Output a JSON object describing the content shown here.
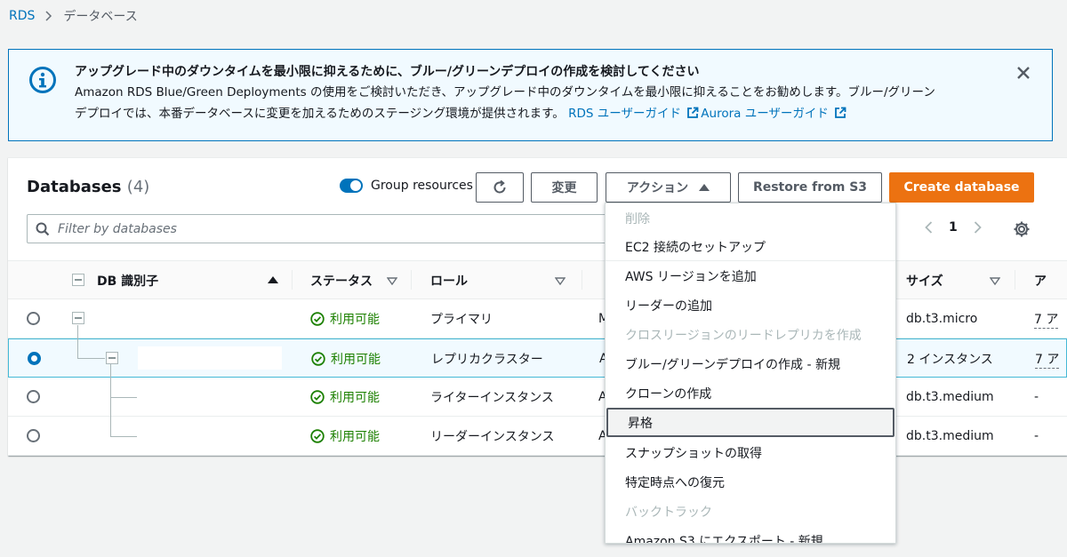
{
  "breadcrumb": {
    "root": "RDS",
    "current": "データベース"
  },
  "banner": {
    "title": "アップグレード中のダウンタイムを最小限に抑えるために、ブルー/グリーンデプロイの作成を検討してください",
    "line1": "Amazon RDS Blue/Green Deployments の使用をご検討いただき、アップグレード中のダウンタイムを最小限に抑えることをお勧めします。ブルー/グリーン",
    "line2": "デプロイでは、本番データベースに変更を加えるためのステージング環境が提供されます。",
    "link1": "RDS ユーザーガイド",
    "link2": "Aurora ユーザーガイド"
  },
  "panel": {
    "title": "Databases",
    "count": "(4)",
    "group_resources": "Group resources",
    "modify": "変更",
    "actions": "アクション",
    "restore": "Restore from S3",
    "create": "Create database",
    "filter_placeholder": "Filter by databases",
    "page": "1"
  },
  "columns": {
    "id": "DB 識別子",
    "status": "ステータス",
    "role": "ロール",
    "size": "サイズ",
    "partial_col": "ア"
  },
  "rows": [
    {
      "status": "利用可能",
      "role": "プライマリ",
      "engine_partial": "M",
      "size": "db.t3.micro",
      "last": "7 ア"
    },
    {
      "status": "利用可能",
      "role": "レプリカクラスター",
      "engine_partial": "A",
      "size": "2 インスタンス",
      "last": "7 ア"
    },
    {
      "status": "利用可能",
      "role": "ライターインスタンス",
      "engine_partial": "A",
      "size": "db.t3.medium",
      "last": "-"
    },
    {
      "status": "利用可能",
      "role": "リーダーインスタンス",
      "engine_partial": "A",
      "size": "db.t3.medium",
      "last": "-"
    }
  ],
  "menu": {
    "items": [
      {
        "label": "削除",
        "disabled": true
      },
      {
        "label": "EC2 接続のセットアップ"
      },
      {
        "label": "AWS リージョンを追加"
      },
      {
        "label": "リーダーの追加"
      },
      {
        "label": "クロスリージョンのリードレプリカを作成",
        "disabled": true
      },
      {
        "label": "ブルー/グリーンデプロイの作成 - 新規"
      },
      {
        "label": "クローンの作成"
      },
      {
        "label": "昇格",
        "active": true
      },
      {
        "label": "スナップショットの取得"
      },
      {
        "label": "特定時点への復元"
      },
      {
        "label": "バックトラック",
        "disabled": true
      },
      {
        "label": "Amazon S3 にエクスポート - 新規"
      }
    ]
  },
  "colors": {
    "accent": "#0073bb",
    "primary_button": "#ec7211",
    "success": "#1d8102"
  }
}
